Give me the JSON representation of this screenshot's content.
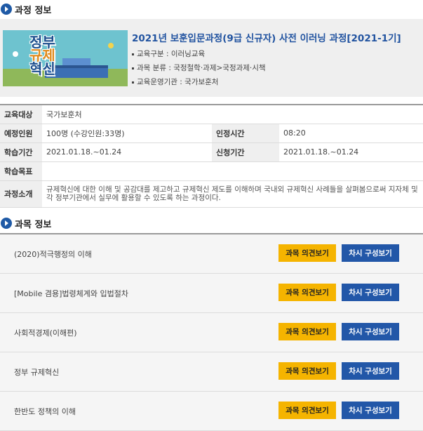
{
  "course_info": {
    "section_title": "과정 정보",
    "title": "2021년 보훈입문과정(9급 신규자) 사전 이러닝 과정[2021-1기]",
    "thumbnail_text": [
      "정부",
      "규제",
      "혁신"
    ],
    "bullets": [
      "교육구분 : 이러닝교육",
      "과목 분류 : 국정철학·과제>국정과제·시책",
      "교육운영기관 : 국가보훈처"
    ],
    "table": {
      "target_label": "교육대상",
      "target_value": "국가보훈처",
      "capacity_label": "예정인원",
      "capacity_value": "100명 (수강인원:33명)",
      "cert_time_label": "인정시간",
      "cert_time_value": "08:20",
      "period_label": "학습기간",
      "period_value": "2021.01.18.~01.24",
      "apply_label": "신청기간",
      "apply_value": "2021.01.18.~01.24",
      "goal_label": "학습목표",
      "goal_value": "",
      "intro_label": "과정소개",
      "intro_value": "규제혁신에 대한 이해 및 공감대를 제고하고 규제혁신 제도를 이해하며 국내외 규제혁신 사례들을 살펴봄으로써 지자체 및 각 정부기관에서 실무에 활용할 수 있도록 하는 과정이다."
    }
  },
  "subjects": {
    "section_title": "과목 정보",
    "opinion_label": "과목 의견보기",
    "compose_label": "차시 구성보기",
    "items": [
      "(2020)적극행정의 이해",
      "[Mobile 겸용]법령체계와 입법절차",
      "사회적경제(이해편)",
      "정부 규제혁신",
      "한반도 정책의 이해"
    ]
  },
  "colors": {
    "accent": "#2153a0",
    "opinion_button": "#f5b400",
    "compose_button": "#2257a8"
  }
}
